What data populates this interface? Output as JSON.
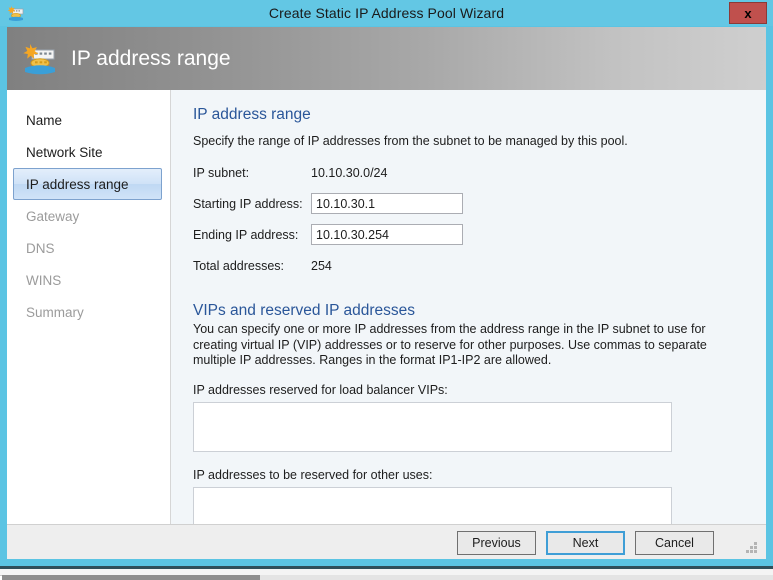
{
  "window": {
    "title": "Create Static IP Address Pool Wizard",
    "title_icon": "ip-pool-icon",
    "close_label": "x",
    "accent_color": "#63c7e4",
    "close_color": "#c0504d"
  },
  "header": {
    "title": "IP address range",
    "icon": "ip-pool-icon"
  },
  "sidebar": {
    "items": [
      {
        "label": "Name",
        "state": "done"
      },
      {
        "label": "Network Site",
        "state": "done"
      },
      {
        "label": "IP address range",
        "state": "selected"
      },
      {
        "label": "Gateway",
        "state": "pending"
      },
      {
        "label": "DNS",
        "state": "pending"
      },
      {
        "label": "WINS",
        "state": "pending"
      },
      {
        "label": "Summary",
        "state": "pending"
      }
    ]
  },
  "content": {
    "heading": "IP address range",
    "description": "Specify the range of IP addresses from the subnet to be managed by this pool.",
    "fields": {
      "subnet_label": "IP subnet:",
      "subnet_value": "10.10.30.0/24",
      "start_label": "Starting IP address:",
      "start_value": "10.10.30.1",
      "end_label": "Ending IP address:",
      "end_value": "10.10.30.254",
      "total_label": "Total addresses:",
      "total_value": "254"
    },
    "vips": {
      "heading": "VIPs and reserved IP addresses",
      "description": "You can specify one or more IP addresses from the address range in the IP subnet to use for creating virtual IP (VIP) addresses or to reserve for other purposes. Use commas to separate multiple IP addresses. Ranges in the format IP1-IP2 are allowed.",
      "lb_label": "IP addresses reserved for load balancer VIPs:",
      "lb_value": "",
      "other_label": "IP addresses to be reserved for other uses:",
      "other_value": ""
    },
    "heading_color": "#2a5699"
  },
  "footer": {
    "previous_label": "Previous",
    "next_label": "Next",
    "cancel_label": "Cancel",
    "focus_color": "#3f9ed6"
  }
}
